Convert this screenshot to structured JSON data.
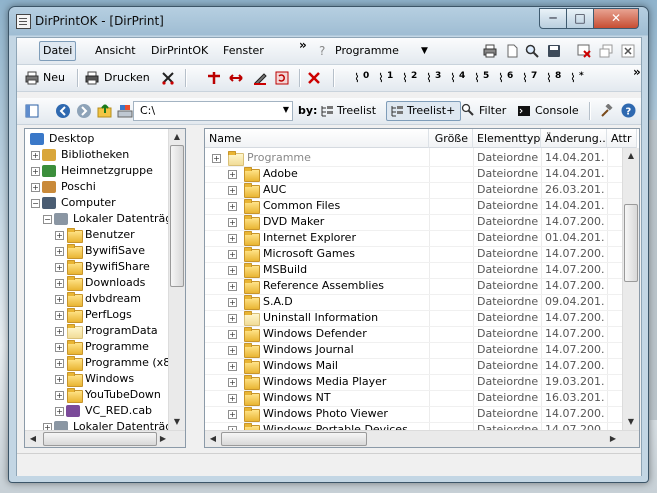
{
  "window": {
    "title": "DirPrintOK - [DirPrint]",
    "min_glyph": "─",
    "max_glyph": "□",
    "close_glyph": "✕"
  },
  "menubar": {
    "items": [
      "Datei",
      "Ansicht",
      "DirPrintOK",
      "Fenster",
      "Programme"
    ],
    "overflow_glyph": "»",
    "help_glyph": "?"
  },
  "toolbar": {
    "new_label": "Neu",
    "print_label": "Drucken",
    "drive_labels": [
      "0",
      "1",
      "2",
      "3",
      "4",
      "5",
      "6",
      "7",
      "8",
      "*"
    ],
    "overflow_glyph": "»"
  },
  "addressbar": {
    "path": "C:\\",
    "by_label": "by:",
    "treelist_label": "Treelist",
    "treelist_plus_label": "Treelist+",
    "filter_label": "Filter",
    "console_label": "Console"
  },
  "tree": {
    "items": [
      {
        "label": "Desktop",
        "icon": "desktop-icon",
        "level": 0,
        "expander": ""
      },
      {
        "label": "Bibliotheken",
        "icon": "library-icon",
        "level": 1,
        "expander": "+"
      },
      {
        "label": "Heimnetzgruppe",
        "icon": "homegroup-icon",
        "level": 1,
        "expander": "+"
      },
      {
        "label": "Poschi",
        "icon": "user-icon",
        "level": 1,
        "expander": "+"
      },
      {
        "label": "Computer",
        "icon": "computer-icon",
        "level": 1,
        "expander": "−"
      },
      {
        "label": "Lokaler Datenträge",
        "icon": "drive-icon",
        "level": 2,
        "expander": "−"
      },
      {
        "label": "Benutzer",
        "icon": "folder-icon",
        "level": 3,
        "expander": "+"
      },
      {
        "label": "BywifiSave",
        "icon": "folder-icon",
        "level": 3,
        "expander": "+"
      },
      {
        "label": "BywifiShare",
        "icon": "folder-icon",
        "level": 3,
        "expander": "+"
      },
      {
        "label": "Downloads",
        "icon": "folder-icon",
        "level": 3,
        "expander": "+"
      },
      {
        "label": "dvbdream",
        "icon": "folder-icon",
        "level": 3,
        "expander": "+"
      },
      {
        "label": "PerfLogs",
        "icon": "folder-icon",
        "level": 3,
        "expander": "+"
      },
      {
        "label": "ProgramData",
        "icon": "folder-pale-icon",
        "level": 3,
        "expander": "+"
      },
      {
        "label": "Programme",
        "icon": "folder-icon",
        "level": 3,
        "expander": "+"
      },
      {
        "label": "Programme (x8",
        "icon": "folder-icon",
        "level": 3,
        "expander": "+"
      },
      {
        "label": "Windows",
        "icon": "folder-icon",
        "level": 3,
        "expander": "+"
      },
      {
        "label": "YouTubeDown",
        "icon": "folder-icon",
        "level": 3,
        "expander": "+"
      },
      {
        "label": "VC_RED.cab",
        "icon": "archive-icon",
        "level": 3,
        "expander": "+"
      },
      {
        "label": "Lokaler Datenträge",
        "icon": "drive-icon",
        "level": 2,
        "expander": "+"
      }
    ]
  },
  "list": {
    "columns": [
      "Name",
      "Größe",
      "Elementtyp",
      "Änderung...",
      "Attr"
    ],
    "parent": {
      "name": "Programme",
      "size": "",
      "type": "Dateiordner",
      "date": "14.04.201..."
    },
    "rows": [
      {
        "name": "Adobe",
        "size": "",
        "type": "Dateiordner",
        "date": "14.04.201...",
        "pale": false
      },
      {
        "name": "AUC",
        "size": "",
        "type": "Dateiordner",
        "date": "26.03.201...",
        "pale": false
      },
      {
        "name": "Common Files",
        "size": "",
        "type": "Dateiordner",
        "date": "14.04.201...",
        "pale": false
      },
      {
        "name": "DVD Maker",
        "size": "",
        "type": "Dateiordner",
        "date": "14.07.200...",
        "pale": false
      },
      {
        "name": "Internet Explorer",
        "size": "",
        "type": "Dateiordner",
        "date": "01.04.201...",
        "pale": false
      },
      {
        "name": "Microsoft Games",
        "size": "",
        "type": "Dateiordner",
        "date": "14.07.200...",
        "pale": false
      },
      {
        "name": "MSBuild",
        "size": "",
        "type": "Dateiordner",
        "date": "14.07.200...",
        "pale": false
      },
      {
        "name": "Reference Assemblies",
        "size": "",
        "type": "Dateiordner",
        "date": "14.07.200...",
        "pale": false
      },
      {
        "name": "S.A.D",
        "size": "",
        "type": "Dateiordner",
        "date": "09.04.201...",
        "pale": false
      },
      {
        "name": "Uninstall Information",
        "size": "",
        "type": "Dateiordner",
        "date": "14.07.200...",
        "pale": true
      },
      {
        "name": "Windows Defender",
        "size": "",
        "type": "Dateiordner",
        "date": "14.07.200...",
        "pale": false
      },
      {
        "name": "Windows Journal",
        "size": "",
        "type": "Dateiordner",
        "date": "14.07.200...",
        "pale": false
      },
      {
        "name": "Windows Mail",
        "size": "",
        "type": "Dateiordner",
        "date": "14.07.200...",
        "pale": false
      },
      {
        "name": "Windows Media Player",
        "size": "",
        "type": "Dateiordner",
        "date": "19.03.201...",
        "pale": false
      },
      {
        "name": "Windows NT",
        "size": "",
        "type": "Dateiordner",
        "date": "16.03.201...",
        "pale": false
      },
      {
        "name": "Windows Photo Viewer",
        "size": "",
        "type": "Dateiordner",
        "date": "14.07.200...",
        "pale": false
      },
      {
        "name": "Windows Portable Devices",
        "size": "",
        "type": "Dateiordner",
        "date": "14.07.200...",
        "pale": false
      }
    ]
  },
  "colors": {
    "accent": "#3a6ea5",
    "folder": "#e9b533",
    "close": "#c74d32"
  }
}
